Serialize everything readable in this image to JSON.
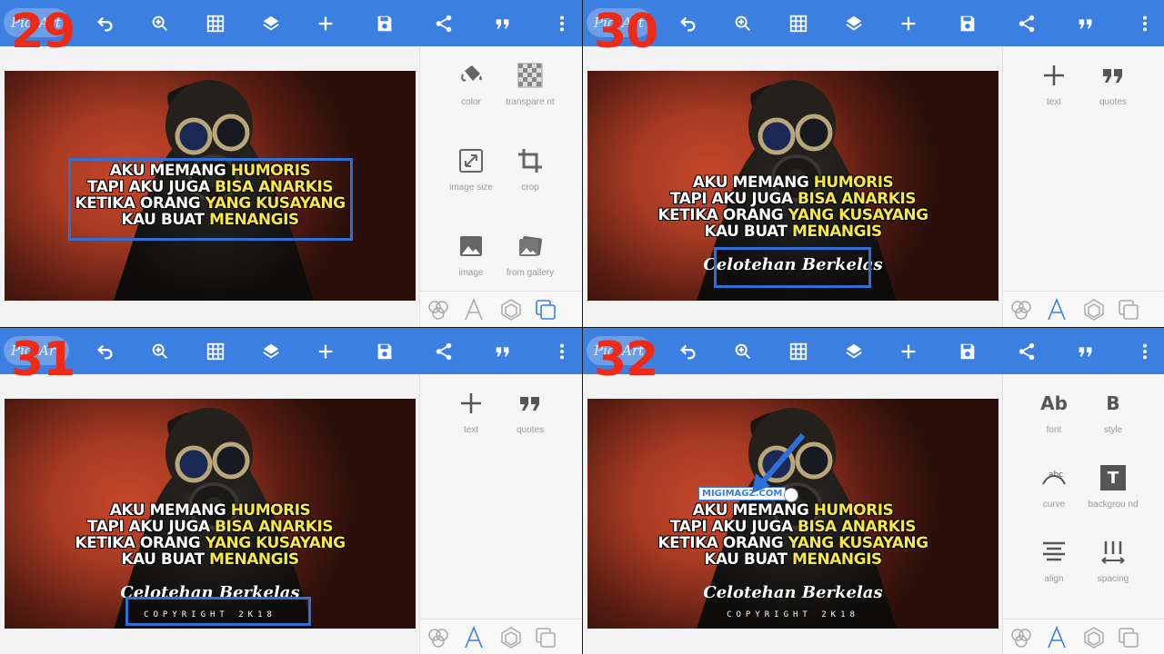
{
  "app": {
    "logo": "PicsArt"
  },
  "steps": [
    "29",
    "30",
    "31",
    "32"
  ],
  "quote": {
    "line1_a": "AKU MEMANG ",
    "line1_b": "HUMORIS",
    "line2_a": "TAPI AKU JUGA ",
    "line2_b": "BISA ANARKIS",
    "line3_a": "KETIKA ORANG ",
    "line3_b": "YANG KUSAYANG",
    "line4_a": "KAU BUAT ",
    "line4_b": "MENANGIS"
  },
  "brand": "Celotehan Berkelas",
  "copyright": "COPYRIGHT 2K18",
  "watermark": "MIGIMAGZ.COM",
  "panel29_tools": [
    {
      "icon": "paint-bucket-icon",
      "label": "color"
    },
    {
      "icon": "transparent-icon",
      "label": "transpare nt"
    },
    {
      "icon": "resize-icon",
      "label": "image size"
    },
    {
      "icon": "crop-icon",
      "label": "crop"
    },
    {
      "icon": "image-icon",
      "label": "image"
    },
    {
      "icon": "gallery-icon",
      "label": "from gallery"
    }
  ],
  "panel30_tools": [
    {
      "icon": "plus-icon",
      "label": "text"
    },
    {
      "icon": "quotes-icon",
      "label": "quotes"
    }
  ],
  "panel32_tools": [
    {
      "icon": "font-icon",
      "label": "font",
      "glyph": "Ab"
    },
    {
      "icon": "style-icon",
      "label": "style",
      "glyph": "B"
    },
    {
      "icon": "curve-icon",
      "label": "curve"
    },
    {
      "icon": "background-icon",
      "label": "backgrou nd",
      "glyph": "T"
    },
    {
      "icon": "align-icon",
      "label": "align"
    },
    {
      "icon": "spacing-icon",
      "label": "spacing"
    }
  ],
  "colors": {
    "toolbar": "#3b7fe0",
    "step": "#ef2a17",
    "highlight": "#f7e84a"
  }
}
